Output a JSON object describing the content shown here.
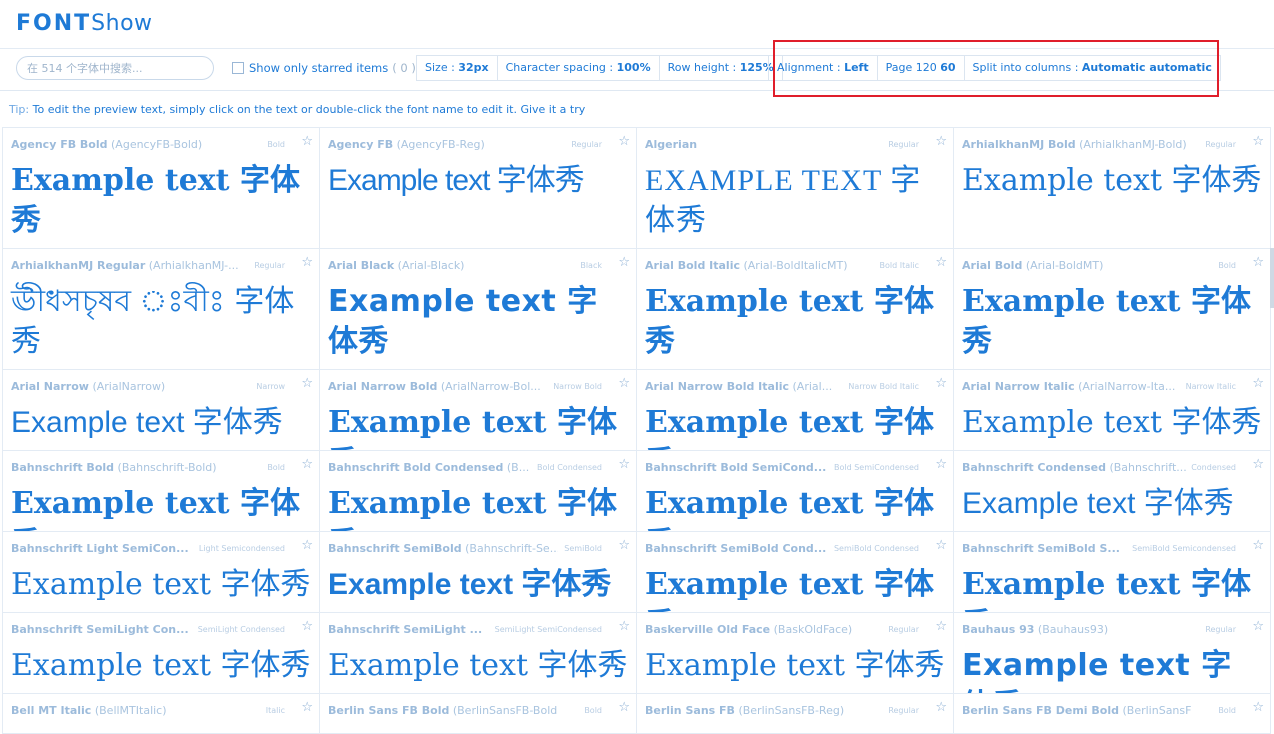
{
  "app": {
    "logo_part1": "FONT",
    "logo_part2": "Show"
  },
  "toolbar": {
    "search_placeholder": "在 514 个字体中搜索...",
    "starred_label": "Show only starred items",
    "starred_count": "( 0 )",
    "size_label": "Size :",
    "size_value": "32px",
    "spacing_label": "Character spacing :",
    "spacing_value": "100%",
    "row_height_label": "Row height :",
    "row_height_value": "125%",
    "alignment_label": "Alignment :",
    "alignment_value": "Left",
    "page_label": "Page 120",
    "page_value": "60",
    "split_label": "Split into columns :",
    "split_value": "Automatic automatic"
  },
  "tip": {
    "label": "Tip:",
    "text": "To edit the preview text, simply  click on the text  or  double-click the font name  to edit it.  Give it a try"
  },
  "sample_text": "Example text 字体秀",
  "fonts": [
    {
      "name": "Agency FB Bold",
      "ps": "(AgencyFB-Bold)",
      "style": "Bold",
      "sample": "Example text 字体秀"
    },
    {
      "name": "Agency FB",
      "ps": "(AgencyFB-Reg)",
      "style": "Regular",
      "sample": "Example text 字体秀"
    },
    {
      "name": "Algerian",
      "ps": "",
      "style": "Regular",
      "sample": "EXAMPLE TEXT 字体秀"
    },
    {
      "name": "ArhialkhanMJ Bold",
      "ps": "(ArhialkhanMJ-Bold)",
      "style": "Regular",
      "sample": "Example text 字体秀"
    },
    {
      "name": "ArhialkhanMJ Regular",
      "ps": "(ArhialkhanMJ-...",
      "style": "Regular",
      "sample": "ঊীধসচৃষব ঃবীঃ 字体秀"
    },
    {
      "name": "Arial Black",
      "ps": "(Arial-Black)",
      "style": "Black",
      "sample": "Example text 字体秀"
    },
    {
      "name": "Arial Bold Italic",
      "ps": "(Arial-BoldItalicMT)",
      "style": "Bold Italic",
      "sample": "Example text 字体秀"
    },
    {
      "name": "Arial Bold",
      "ps": "(Arial-BoldMT)",
      "style": "Bold",
      "sample": "Example text 字体秀"
    },
    {
      "name": "Arial Narrow",
      "ps": "(ArialNarrow)",
      "style": "Narrow",
      "sample": "Example text 字体秀"
    },
    {
      "name": "Arial Narrow Bold",
      "ps": "(ArialNarrow-Bol...",
      "style": "Narrow Bold",
      "sample": "Example text 字体秀"
    },
    {
      "name": "Arial Narrow Bold Italic",
      "ps": "(Arial...",
      "style": "Narrow Bold Italic",
      "sample": "Example text 字体秀"
    },
    {
      "name": "Arial Narrow Italic",
      "ps": "(ArialNarrow-Ita...",
      "style": "Narrow Italic",
      "sample": "Example text 字体秀"
    },
    {
      "name": "Bahnschrift Bold",
      "ps": "(Bahnschrift-Bold)",
      "style": "Bold",
      "sample": "Example text 字体秀"
    },
    {
      "name": "Bahnschrift Bold Condensed",
      "ps": "(B...",
      "style": "Bold Condensed",
      "sample": "Example text 字体秀"
    },
    {
      "name": "Bahnschrift Bold SemiCond...",
      "ps": "",
      "style": "Bold SemiCondensed",
      "sample": "Example text 字体秀"
    },
    {
      "name": "Bahnschrift Condensed",
      "ps": "(Bahnschrift...",
      "style": "Condensed",
      "sample": "Example text 字体秀"
    },
    {
      "name": "Bahnschrift Light SemiCon...",
      "ps": "",
      "style": "Light Semicondensed",
      "sample": "Example text 字体秀"
    },
    {
      "name": "Bahnschrift SemiBold",
      "ps": "(Bahnschrift-Se...",
      "style": "SemiBold",
      "sample": "Example text 字体秀"
    },
    {
      "name": "Bahnschrift SemiBold Cond...",
      "ps": "",
      "style": "SemiBold Condensed",
      "sample": "Example text 字体秀"
    },
    {
      "name": "Bahnschrift SemiBold S...",
      "ps": "",
      "style": "SemiBold Semicondensed",
      "sample": "Example text 字体秀"
    },
    {
      "name": "Bahnschrift SemiLight Con...",
      "ps": "",
      "style": "SemiLight Condensed",
      "sample": "Example text 字体秀"
    },
    {
      "name": "Bahnschrift SemiLight ...",
      "ps": "",
      "style": "SemiLight SemiCondensed",
      "sample": "Example text 字体秀"
    },
    {
      "name": "Baskerville Old Face",
      "ps": "(BaskOldFace)",
      "style": "Regular",
      "sample": "Example text 字体秀"
    },
    {
      "name": "Bauhaus 93",
      "ps": "(Bauhaus93)",
      "style": "Regular",
      "sample": "Example text 字体秀"
    },
    {
      "name": "Bell MT Italic",
      "ps": "(BellMTItalic)",
      "style": "Italic",
      "sample": ""
    },
    {
      "name": "Berlin Sans FB Bold",
      "ps": "(BerlinSansFB-Bold)",
      "style": "Bold",
      "sample": ""
    },
    {
      "name": "Berlin Sans FB",
      "ps": "(BerlinSansFB-Reg)",
      "style": "Regular",
      "sample": ""
    },
    {
      "name": "Berlin Sans FB Demi Bold",
      "ps": "(BerlinSansFBD...",
      "style": "Bold",
      "sample": ""
    }
  ],
  "colors": {
    "accent": "#1e7ad6",
    "highlight_box": "#e01e2b",
    "muted": "#a9c4df"
  }
}
